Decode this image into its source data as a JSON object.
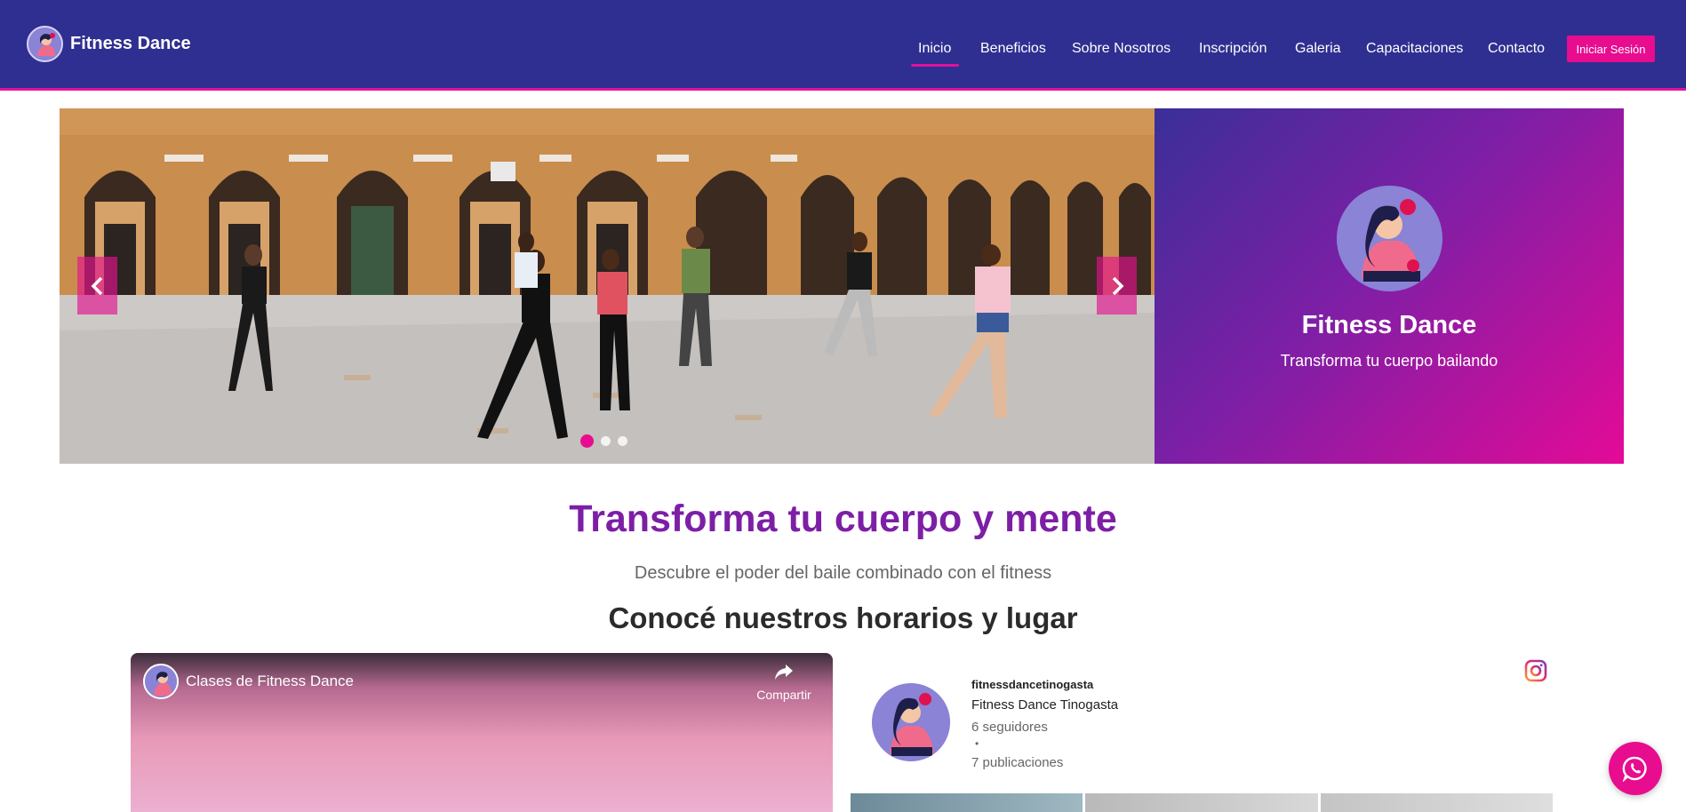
{
  "header": {
    "brand": "Fitness Dance",
    "nav": [
      {
        "label": "Inicio",
        "active": true
      },
      {
        "label": "Beneficios",
        "active": false
      },
      {
        "label": "Sobre Nosotros",
        "active": false
      },
      {
        "label": "Inscripción",
        "active": false
      },
      {
        "label": "Galeria",
        "active": false
      },
      {
        "label": "Capacitaciones",
        "active": false
      },
      {
        "label": "Contacto",
        "active": false
      }
    ],
    "login_label": "Iniciar Sesión"
  },
  "hero": {
    "slide_count": 3,
    "active_slide": 1,
    "panel_title": "Fitness Dance",
    "panel_subtitle": "Transforma tu cuerpo bailando"
  },
  "intro": {
    "title": "Transforma tu cuerpo y mente",
    "subtitle": "Descubre el poder del baile combinado con el fitness"
  },
  "schedule": {
    "title": "Conocé nuestros horarios y lugar"
  },
  "video": {
    "title": "Clases de Fitness Dance",
    "share_label": "Compartir"
  },
  "instagram": {
    "username": "fitnessdancetinogasta",
    "display_name": "Fitness Dance Tinogasta",
    "followers": "6 seguidores",
    "bullet": "•",
    "posts": "7 publicaciones"
  },
  "colors": {
    "nav_bg": "#2f2f91",
    "accent": "#e80c8f",
    "title_purple": "#7d1fa6"
  },
  "icons": {
    "prev": "chevron-left-icon",
    "next": "chevron-right-icon",
    "share": "share-icon",
    "instagram": "instagram-icon",
    "whatsapp": "whatsapp-icon"
  }
}
